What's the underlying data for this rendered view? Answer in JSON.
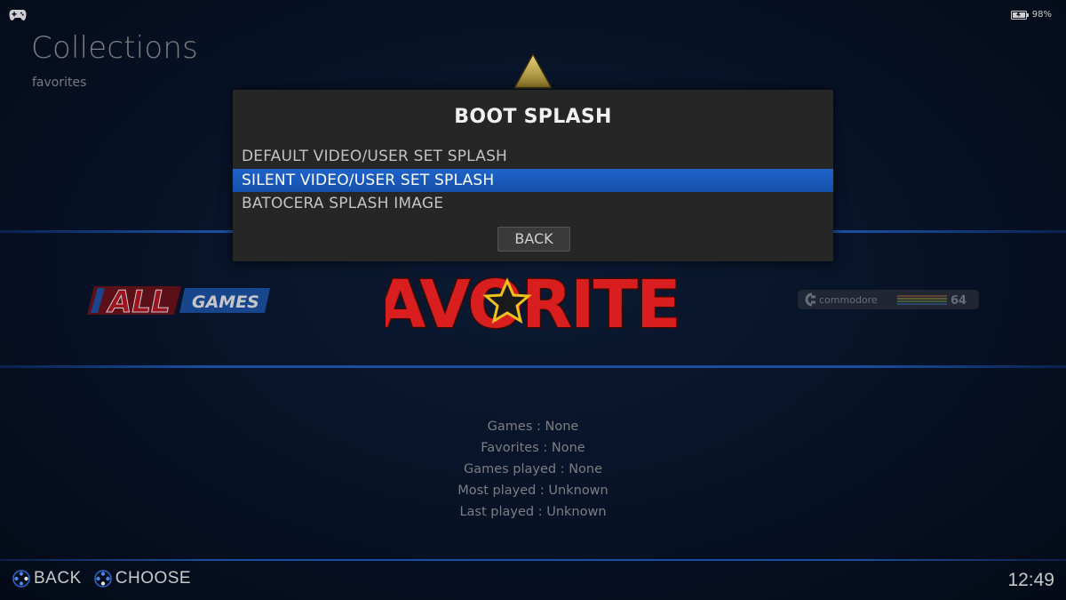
{
  "status": {
    "battery": "98%",
    "clock": "12:49"
  },
  "header": {
    "title": "Collections",
    "subtitle": "favorites"
  },
  "carousel": {
    "left_logo": {
      "part1": "ALL",
      "part2": "GAMES"
    },
    "center_logo": {
      "text": "FAVORITES"
    },
    "right_logo": {
      "brand": "commodore",
      "model": "64"
    }
  },
  "stats": {
    "games": "Games : None",
    "favorites": "Favorites : None",
    "games_played": "Games played : None",
    "most_played": "Most played : Unknown",
    "last_played": "Last played : Unknown"
  },
  "footer": {
    "back_label": "BACK",
    "choose_label": "CHOOSE"
  },
  "dialog": {
    "title": "BOOT SPLASH",
    "options": [
      {
        "label": "DEFAULT VIDEO/USER SET SPLASH",
        "selected": false
      },
      {
        "label": "SILENT VIDEO/USER SET SPLASH",
        "selected": true
      },
      {
        "label": "BATOCERA SPLASH IMAGE",
        "selected": false
      }
    ],
    "back_button": "BACK"
  },
  "colors": {
    "accent": "#1b5bbf",
    "favorites_red": "#d81e1e",
    "favorites_star": "#f2c01c"
  }
}
